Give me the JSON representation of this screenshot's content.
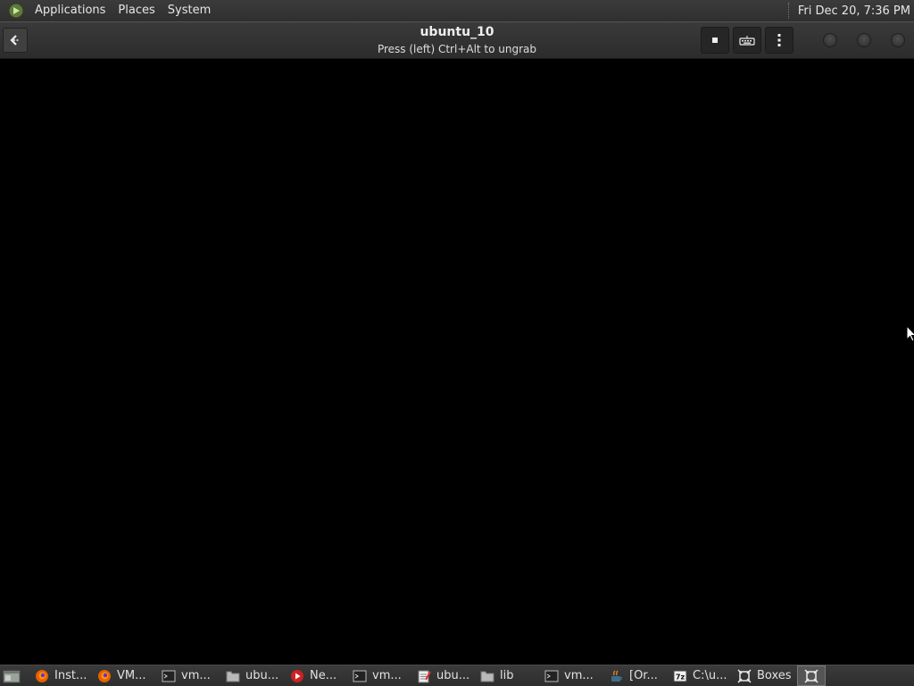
{
  "top_panel": {
    "menus": [
      "Applications",
      "Places",
      "System"
    ],
    "clock": "Fri Dec 20,  7:36 PM"
  },
  "header": {
    "title": "ubuntu_10",
    "subtitle": "Press (left) Ctrl+Alt to ungrab"
  },
  "taskbar": {
    "items": [
      {
        "label": "Inst...",
        "icon": "firefox-icon"
      },
      {
        "label": "VM...",
        "icon": "firefox-icon"
      },
      {
        "label": "vm...",
        "icon": "terminal-icon"
      },
      {
        "label": "ubu...",
        "icon": "folder-icon"
      },
      {
        "label": "Ne...",
        "icon": "media-player-icon"
      },
      {
        "label": "vm...",
        "icon": "terminal-icon"
      },
      {
        "label": "ubu...",
        "icon": "text-editor-icon"
      },
      {
        "label": "lib",
        "icon": "folder-icon"
      },
      {
        "label": "vm...",
        "icon": "terminal-icon"
      },
      {
        "label": "[Or...",
        "icon": "java-icon"
      },
      {
        "label": "C:\\u...",
        "icon": "archive-7z-icon"
      },
      {
        "label": "Boxes",
        "icon": "boxes-icon"
      }
    ]
  },
  "colors": {
    "panel": "#333333",
    "vm_background": "#000000",
    "firefox": "#e66000",
    "media_player": "#cc2222"
  }
}
